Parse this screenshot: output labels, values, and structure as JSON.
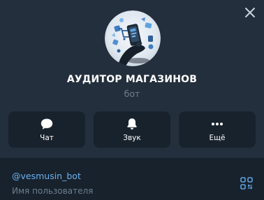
{
  "profile": {
    "name": "АУДИТОР МАГАЗИНОВ",
    "type": "бот",
    "avatar_icon": "shopping-audit-avatar"
  },
  "actions": [
    {
      "label": "Чат",
      "icon": "chat-bubble-icon"
    },
    {
      "label": "Звук",
      "icon": "bell-icon"
    },
    {
      "label": "Ещё",
      "icon": "more-dots-icon"
    }
  ],
  "info": {
    "username": "@vesmusin_bot",
    "username_label": "Имя пользователя"
  },
  "colors": {
    "panel": "#242f3d",
    "background": "#18222d",
    "link": "#6ab2f2",
    "muted": "#6d7f8f",
    "accent": "#5ea2e0"
  },
  "icons": {
    "close": "close-icon",
    "qr": "qr-code-icon"
  }
}
